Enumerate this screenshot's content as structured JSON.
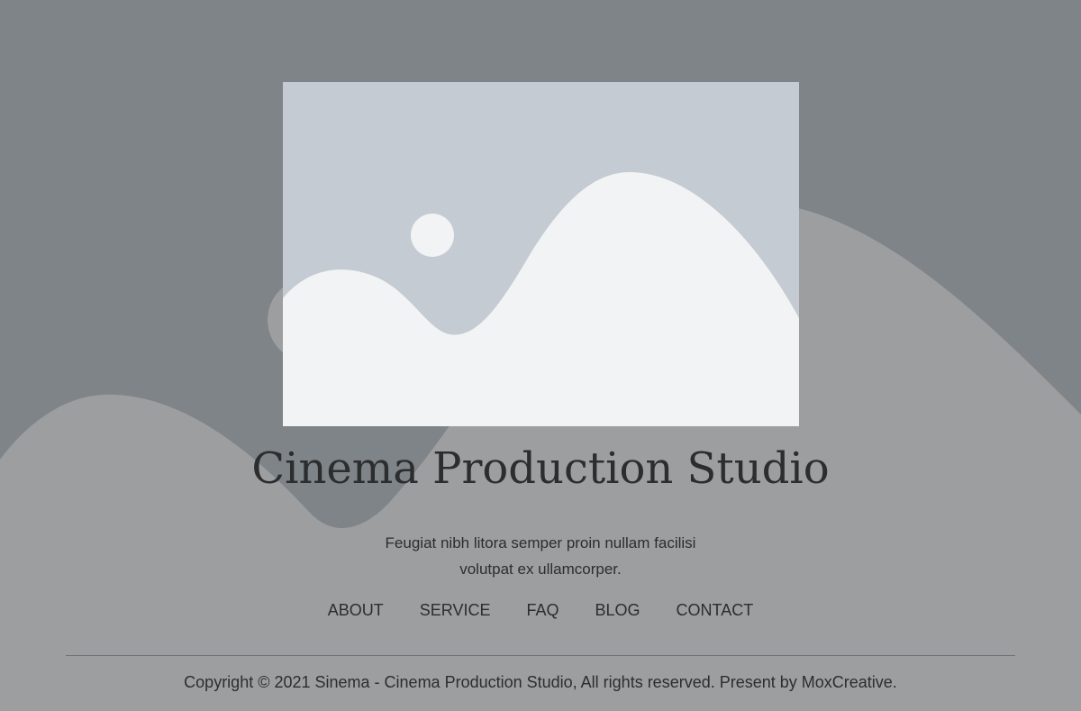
{
  "hero": {
    "title": "Cinema Production Studio",
    "tagline": "Feugiat nibh litora semper proin nullam facilisi volutpat ex ullamcorper.",
    "image_icon": "image-placeholder-icon"
  },
  "footer_nav": {
    "items": [
      {
        "label": "ABOUT"
      },
      {
        "label": "SERVICE"
      },
      {
        "label": "FAQ"
      },
      {
        "label": "BLOG"
      },
      {
        "label": "CONTACT"
      }
    ]
  },
  "footer": {
    "copyright": "Copyright © 2021 Sinema - Cinema Production Studio, All rights reserved. Present by MoxCreative."
  },
  "colors": {
    "background": "#7f8488",
    "hill": "#9d9ea0",
    "image_bg": "#c4cbd2",
    "image_fg": "#f2f3f5",
    "text": "#2b2d2f"
  }
}
